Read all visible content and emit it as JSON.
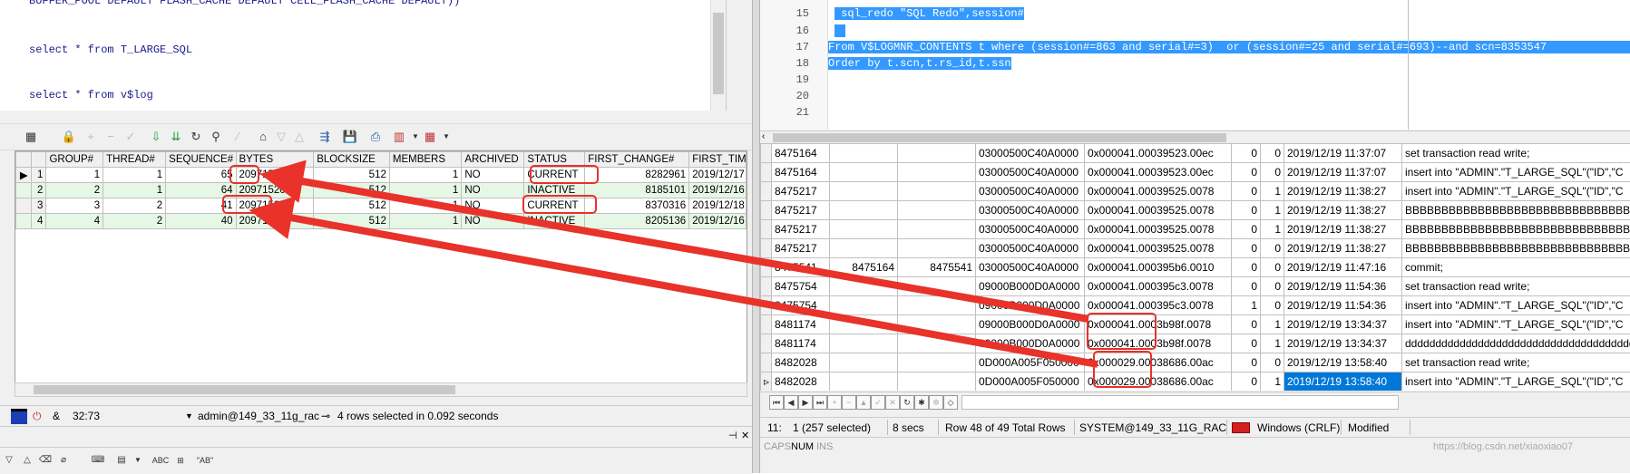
{
  "left": {
    "editor_lines": [
      "BUFFER_POOL DEFAULT FLASH_CACHE DEFAULT CELL_FLASH_CACHE DEFAULT))",
      "select * from T_LARGE_SQL",
      "select * from v$log"
    ],
    "grid": {
      "headers": [
        "GROUP#",
        "THREAD#",
        "SEQUENCE#",
        "BYTES",
        "BLOCKSIZE",
        "MEMBERS",
        "ARCHIVED",
        "STATUS",
        "FIRST_CHANGE#",
        "FIRST_TIM"
      ],
      "rows": [
        {
          "rownum": "1",
          "group": "1",
          "thread": "1",
          "sequence": "65",
          "bytes": "209715200",
          "blocksize": "512",
          "members": "1",
          "archived": "NO",
          "status": "CURRENT",
          "first_change": "8282961",
          "first_time": "2019/12/17"
        },
        {
          "rownum": "2",
          "group": "2",
          "thread": "1",
          "sequence": "64",
          "bytes": "209715200",
          "blocksize": "512",
          "members": "1",
          "archived": "NO",
          "status": "INACTIVE",
          "first_change": "8185101",
          "first_time": "2019/12/16"
        },
        {
          "rownum": "3",
          "group": "3",
          "thread": "2",
          "sequence": "41",
          "bytes": "209715200",
          "blocksize": "512",
          "members": "1",
          "archived": "NO",
          "status": "CURRENT",
          "first_change": "8370316",
          "first_time": "2019/12/18"
        },
        {
          "rownum": "4",
          "group": "4",
          "thread": "2",
          "sequence": "40",
          "bytes": "209715200",
          "blocksize": "512",
          "members": "1",
          "archived": "NO",
          "status": "INACTIVE",
          "first_change": "8205136",
          "first_time": "2019/12/16"
        }
      ]
    },
    "status": {
      "position": "32:73",
      "connection": "admin@149_33_11g_rac",
      "message": "4 rows selected in 0.092 seconds"
    },
    "bottom_toolbar": {
      "abc": "ABC",
      "ab_quoted": "\"AB\""
    }
  },
  "right": {
    "line_numbers": [
      "15",
      "16",
      "17",
      "18",
      "19",
      "20",
      "21"
    ],
    "code": {
      "line15": " sql_redo \"SQL Redo\",session#",
      "line17": "From V$LOGMNR_CONTENTS t where (session#=863 and serial#=3)  or (session#=25 and serial#=693)--and scn=8353547",
      "line18": "Order by t.scn,t.rs_id,t.ssn"
    },
    "grid_rows": [
      {
        "scn": "8475164",
        "start_scn": "",
        "commit_scn": "",
        "xid": "03000500C40A0000",
        "rs_id": "0x000041.00039523.00ec",
        "a": "0",
        "b": "0",
        "time": "2019/12/19 11:37:07",
        "sql": "set transaction read write;"
      },
      {
        "scn": "8475164",
        "start_scn": "",
        "commit_scn": "",
        "xid": "03000500C40A0000",
        "rs_id": "0x000041.00039523.00ec",
        "a": "0",
        "b": "0",
        "time": "2019/12/19 11:37:07",
        "sql": "insert into \"ADMIN\".\"T_LARGE_SQL\"(\"ID\",\"C"
      },
      {
        "scn": "8475217",
        "start_scn": "",
        "commit_scn": "",
        "xid": "03000500C40A0000",
        "rs_id": "0x000041.00039525.0078",
        "a": "0",
        "b": "1",
        "time": "2019/12/19 11:38:27",
        "sql": "insert into \"ADMIN\".\"T_LARGE_SQL\"(\"ID\",\"C"
      },
      {
        "scn": "8475217",
        "start_scn": "",
        "commit_scn": "",
        "xid": "03000500C40A0000",
        "rs_id": "0x000041.00039525.0078",
        "a": "0",
        "b": "1",
        "time": "2019/12/19 11:38:27",
        "sql": "BBBBBBBBBBBBBBBBBBBBBBBBBBBBBBBBBBBBBBBB"
      },
      {
        "scn": "8475217",
        "start_scn": "",
        "commit_scn": "",
        "xid": "03000500C40A0000",
        "rs_id": "0x000041.00039525.0078",
        "a": "0",
        "b": "1",
        "time": "2019/12/19 11:38:27",
        "sql": "BBBBBBBBBBBBBBBBBBBBBBBBBBBBBBBBBBBBBBBB"
      },
      {
        "scn": "8475217",
        "start_scn": "",
        "commit_scn": "",
        "xid": "03000500C40A0000",
        "rs_id": "0x000041.00039525.0078",
        "a": "0",
        "b": "0",
        "time": "2019/12/19 11:38:27",
        "sql": "BBBBBBBBBBBBBBBBBBBBBBBBBBBBBBBBBBBBBBBB"
      },
      {
        "scn": "8475541",
        "start_scn": "8475164",
        "commit_scn": "8475541",
        "xid": "03000500C40A0000",
        "rs_id": "0x000041.000395b6.0010",
        "a": "0",
        "b": "0",
        "time": "2019/12/19 11:47:16",
        "sql": "commit;"
      },
      {
        "scn": "8475754",
        "start_scn": "",
        "commit_scn": "",
        "xid": "09000B000D0A0000",
        "rs_id": "0x000041.000395c3.0078",
        "a": "0",
        "b": "0",
        "time": "2019/12/19 11:54:36",
        "sql": "set transaction read write;"
      },
      {
        "scn": "8475754",
        "start_scn": "",
        "commit_scn": "",
        "xid": "09000B000D0A0000",
        "rs_id": "0x000041.000395c3.0078",
        "a": "1",
        "b": "0",
        "time": "2019/12/19 11:54:36",
        "sql": "insert into \"ADMIN\".\"T_LARGE_SQL\"(\"ID\",\"C"
      },
      {
        "scn": "8481174",
        "start_scn": "",
        "commit_scn": "",
        "xid": "09000B000D0A0000",
        "rs_id": "0x000041.0003b98f.0078",
        "a": "0",
        "b": "1",
        "time": "2019/12/19 13:34:37",
        "sql": "insert into \"ADMIN\".\"T_LARGE_SQL\"(\"ID\",\"C"
      },
      {
        "scn": "8481174",
        "start_scn": "",
        "commit_scn": "",
        "xid": "09000B000D0A0000",
        "rs_id": "0x000041.0003b98f.0078",
        "a": "0",
        "b": "1",
        "time": "2019/12/19 13:34:37",
        "sql": "dddddddddddddddddddddddddddddddddddddddd"
      },
      {
        "scn": "8482028",
        "start_scn": "",
        "commit_scn": "",
        "xid": "0D000A005F050000",
        "rs_id": "0x000029.00038686.00ac",
        "a": "0",
        "b": "0",
        "time": "2019/12/19 13:58:40",
        "sql": "set transaction read write;"
      },
      {
        "scn": "8482028",
        "start_scn": "",
        "commit_scn": "",
        "xid": "0D000A005F050000",
        "rs_id": "0x000029.00038686.00ac",
        "a": "0",
        "b": "1",
        "time": "2019/12/19 13:58:40",
        "sql": "insert into \"ADMIN\".\"T_LARGE_SQL\"(\"ID\",\"C"
      }
    ],
    "status": {
      "cursor": "11:",
      "selection": "1 (257 selected)",
      "elapsed": "8 secs",
      "row_info": "Row 48 of 49 Total Rows",
      "connection": "SYSTEM@149_33_11G_RAC",
      "line_ending": "Windows (CRLF)",
      "modified": "Modified"
    },
    "status2": {
      "caps": "CAPS",
      "num": "NUM",
      "ins": "INS",
      "watermark": "https://blog.csdn.net/xiaoxiao07"
    }
  },
  "colors": {
    "annotation": "#e8322a",
    "selection": "#3399ff",
    "alt_row": "#e6f7e6"
  }
}
